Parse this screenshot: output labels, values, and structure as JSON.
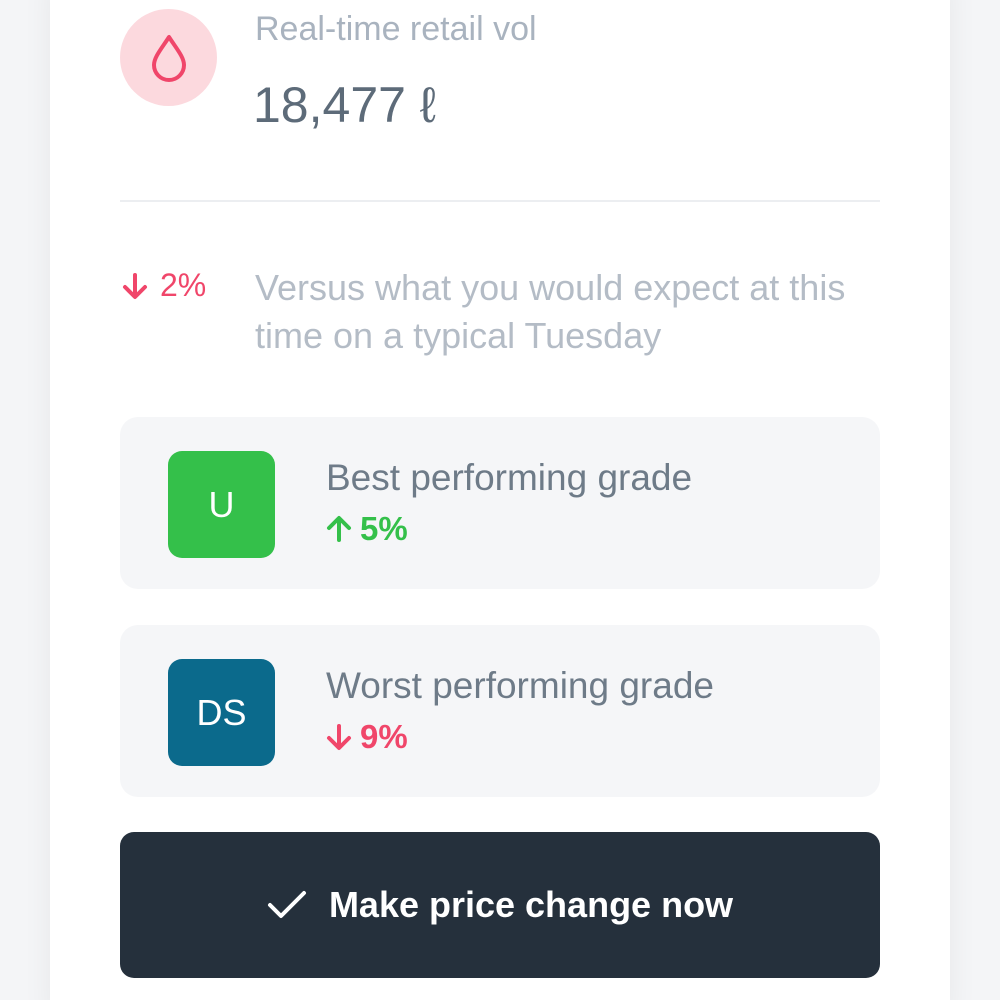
{
  "metric": {
    "icon": "droplet-icon",
    "label": "Real-time retail vol",
    "value": "18,477 ℓ"
  },
  "comparison": {
    "direction": "down",
    "delta": "2%",
    "text": "Versus what you would expect at this time on a typical Tuesday"
  },
  "grades": {
    "best": {
      "badge": "U",
      "badge_color": "#34c04a",
      "title": "Best performing grade",
      "direction": "up",
      "delta": "5%"
    },
    "worst": {
      "badge": "DS",
      "badge_color": "#0b6a8c",
      "title": "Worst performing grade",
      "direction": "down",
      "delta": "9%"
    }
  },
  "action": {
    "icon": "checkmark-icon",
    "label": "Make price change now"
  },
  "colors": {
    "negative": "#f0466a",
    "positive": "#34c04a",
    "button_bg": "#25303c"
  }
}
